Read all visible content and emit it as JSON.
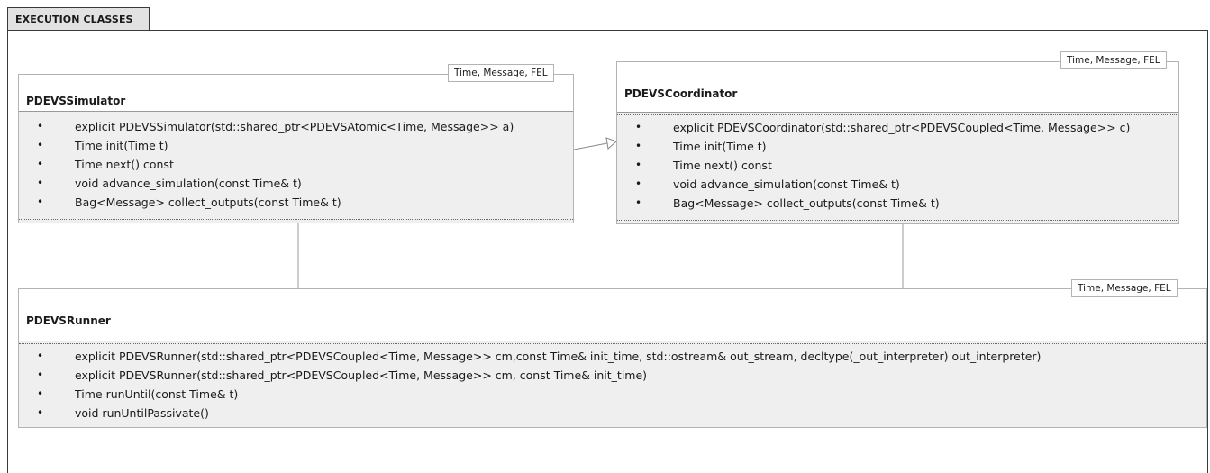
{
  "package": {
    "title": "EXECUTION CLASSES"
  },
  "classes": {
    "simulator": {
      "name": "PDEVSSimulator",
      "template_params": "Time, Message, FEL",
      "methods": [
        "explicit PDEVSSimulator(std::shared_ptr<PDEVSAtomic<Time, Message>> a)",
        "Time init(Time t)",
        "Time next() const",
        "void advance_simulation(const Time& t)",
        "Bag<Message> collect_outputs(const Time& t)"
      ]
    },
    "coordinator": {
      "name": "PDEVSCoordinator",
      "template_params": "Time, Message, FEL",
      "methods": [
        "explicit PDEVSCoordinator(std::shared_ptr<PDEVSCoupled<Time, Message>> c)",
        "Time init(Time t)",
        "Time next() const",
        "void advance_simulation(const Time& t)",
        "Bag<Message> collect_outputs(const Time& t)"
      ]
    },
    "runner": {
      "name": "PDEVSRunner",
      "template_params": "Time, Message, FEL",
      "methods": [
        "explicit PDEVSRunner(std::shared_ptr<PDEVSCoupled<Time, Message>> cm,const Time& init_time, std::ostream& out_stream,   decltype(_out_interpreter) out_interpreter)",
        "explicit PDEVSRunner(std::shared_ptr<PDEVSCoupled<Time, Message>> cm, const Time& init_time)",
        "Time runUntil(const Time& t)",
        "void runUntilPassivate()"
      ]
    }
  },
  "bullet_glyph": "•"
}
